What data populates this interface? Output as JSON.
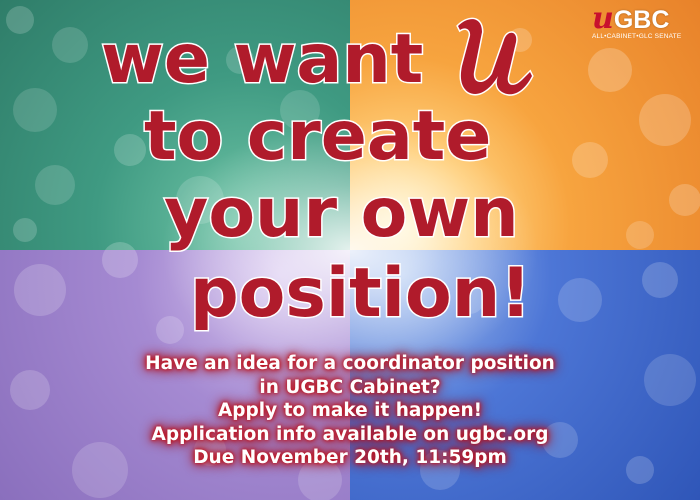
{
  "logo": {
    "mark": "u",
    "name": "GBC",
    "tagline": "ALL•CABINET•GLC SENATE"
  },
  "headline": {
    "line1": "we want",
    "line1_mark": "u",
    "line2": "to create",
    "line3": "your own",
    "line4": "position!"
  },
  "info": {
    "lines": [
      "Have an idea for a coordinator position",
      "in UGBC Cabinet?",
      "Apply to make it happen!",
      "Application info available on ugbc.org",
      "Due November 20th, 11:59pm"
    ]
  },
  "colors": {
    "headline": "#b01b2b",
    "brand_red": "#c8102e",
    "quad_green": "#3f9a82",
    "quad_orange": "#f7a43f",
    "quad_purple": "#8a6fbd",
    "quad_blue": "#2f56b8"
  }
}
